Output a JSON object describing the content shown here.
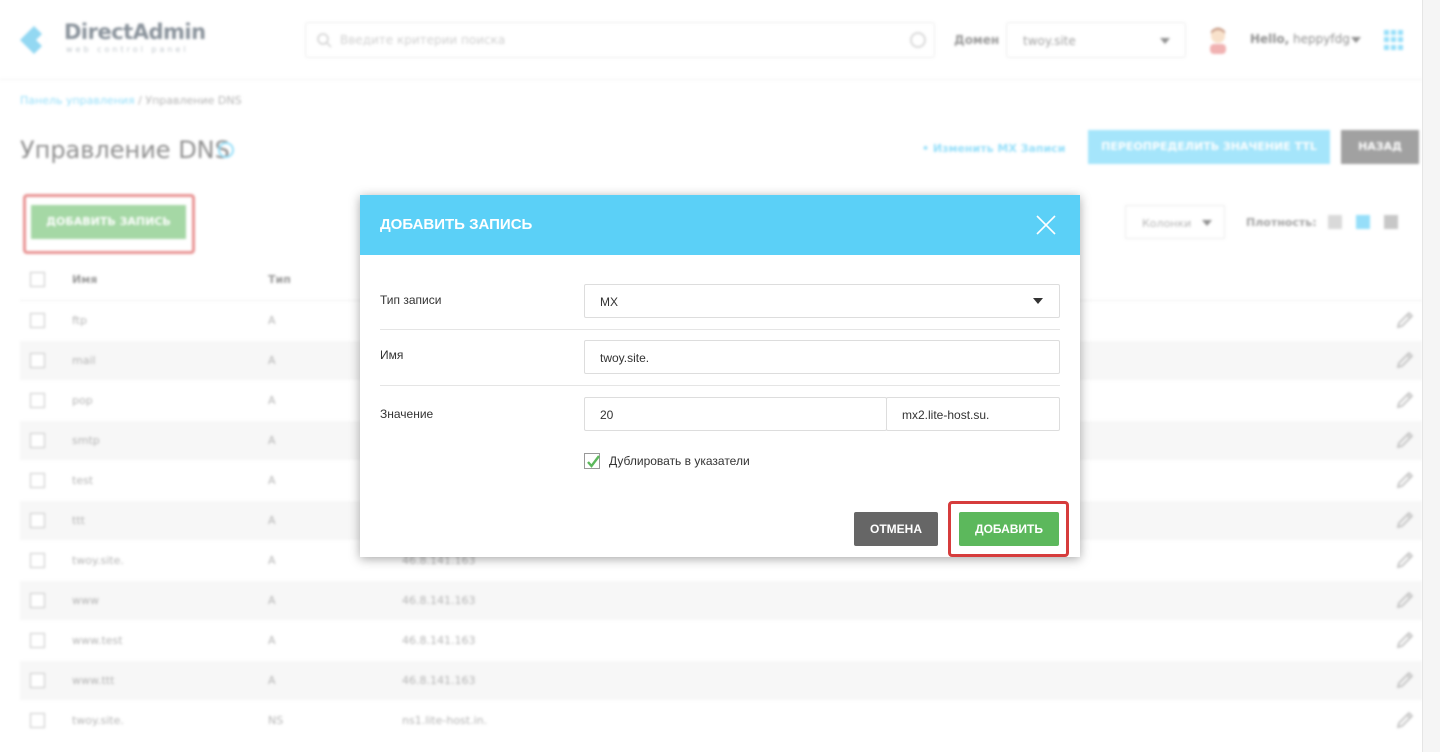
{
  "colors": {
    "accent": "#5bd0f7",
    "success": "#5cb85c",
    "highlight": "#d63c3c"
  },
  "header": {
    "logo_title": "DirectAdmin",
    "logo_subtitle": "web control panel",
    "search_placeholder": "Введите критерии поиска",
    "domain_label": "Домен",
    "domain_value": "twoy.site",
    "greeting": "Hello,",
    "username": "heppyfdg"
  },
  "breadcrumb": {
    "home": "Панель управления",
    "separator": " / ",
    "current": "Управление DNS"
  },
  "page": {
    "title": "Управление DNS",
    "mx_link": "• Изменить MX Записи",
    "ttl_button": "ПЕРЕОПРЕДЕЛИТЬ ЗНАЧЕНИЕ TTL",
    "back_button": "НАЗАД",
    "add_record_button": "ДОБАВИТЬ ЗАПИСЬ",
    "columns_select": "Колонки",
    "density_label": "Плотность:"
  },
  "table": {
    "headers": [
      "Имя",
      "Тип",
      ""
    ],
    "rows": [
      {
        "name": "ftp",
        "type": "A",
        "value": ""
      },
      {
        "name": "mail",
        "type": "A",
        "value": ""
      },
      {
        "name": "pop",
        "type": "A",
        "value": ""
      },
      {
        "name": "smtp",
        "type": "A",
        "value": ""
      },
      {
        "name": "test",
        "type": "A",
        "value": ""
      },
      {
        "name": "ttt",
        "type": "A",
        "value": ""
      },
      {
        "name": "twoy.site.",
        "type": "A",
        "value": "46.8.141.163"
      },
      {
        "name": "www",
        "type": "A",
        "value": "46.8.141.163"
      },
      {
        "name": "www.test",
        "type": "A",
        "value": "46.8.141.163"
      },
      {
        "name": "www.ttt",
        "type": "A",
        "value": "46.8.141.163"
      },
      {
        "name": "twoy.site.",
        "type": "NS",
        "value": "ns1.lite-host.in."
      }
    ]
  },
  "modal": {
    "title": "ДОБАВИТЬ ЗАПИСЬ",
    "record_type_label": "Тип записи",
    "record_type_value": "MX",
    "name_label": "Имя",
    "name_value": "twoy.site.",
    "value_label": "Значение",
    "value_priority": "20",
    "value_host": "mx2.lite-host.su.",
    "duplicate_label": "Дублировать в указатели",
    "duplicate_checked": true,
    "cancel_button": "ОТМЕНА",
    "add_button": "ДОБАВИТЬ"
  }
}
